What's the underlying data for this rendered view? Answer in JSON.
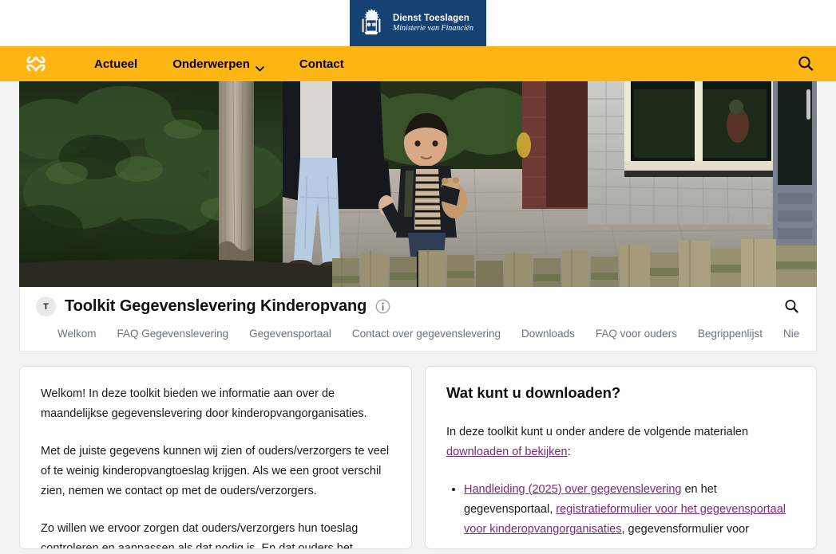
{
  "logo": {
    "organisation": "Dienst Toeslagen",
    "ministry": "Ministerie van Financiën",
    "crest_icon": "dutch-government-crest-icon",
    "bar_color": "#154273"
  },
  "navbar": {
    "background_color": "#ffb612",
    "brand_icon": "knot-logo-icon",
    "links": [
      {
        "label": "Actueel",
        "has_chevron": false
      },
      {
        "label": "Onderwerpen",
        "has_chevron": true
      },
      {
        "label": "Contact",
        "has_chevron": false
      }
    ],
    "search_icon": "search-icon"
  },
  "hero": {
    "alt": "Volwassene in zwarte jas met lichte spijkerbroek loopt hand in hand met een jong kind over een stoep langs een heg en een grijs bakstenen gebouw"
  },
  "title_bar": {
    "avatar_letter": "T",
    "title": "Toolkit Gegevenslevering Kinderopvang",
    "info_icon": "info-circle-icon",
    "search_icon": "search-icon",
    "tabs": [
      {
        "label": "Welkom",
        "active": true
      },
      {
        "label": "FAQ Gegevenslevering",
        "active": false
      },
      {
        "label": "Gegevensportaal",
        "active": false
      },
      {
        "label": "Contact over gegevenslevering",
        "active": false
      },
      {
        "label": "Downloads",
        "active": false
      },
      {
        "label": "FAQ voor ouders",
        "active": false
      },
      {
        "label": "Begrippenlijst",
        "active": false
      },
      {
        "label": "Nieuwsbrieven",
        "active": false
      }
    ]
  },
  "left_card": {
    "paragraph_1": "Welkom! In deze toolkit bieden we informatie aan over de maandelijkse gegevenslevering door kinderopvangorganisaties.",
    "paragraph_2": "Met de juiste gegevens kunnen wij zien of ouders/verzorgers te veel of te weinig kinderopvangtoeslag krijgen. Als we een groot verschil zien, nemen we contact op met de ouders/verzorgers.",
    "paragraph_3": "Zo willen we ervoor zorgen dat ouders/verzorgers hun toeslag controleren en aanpassen als dat nodig is. En dat ouders het"
  },
  "right_card": {
    "heading": "Wat kunt u downloaden?",
    "intro_before_link": "In deze toolkit kunt u onder andere de volgende materialen ",
    "intro_link": "downloaden of bekijken",
    "intro_after_link": ":",
    "bullet_1": {
      "link_1": "Handleiding (2025) over gegevenslevering",
      "text_1": " en het gegevensportaal, ",
      "link_2": "registratieformulier voor het gegevensportaal voor kinderopvangorganisaties",
      "text_2": ", gegevensformulier voor"
    },
    "link_color": "#7b2a7b"
  }
}
